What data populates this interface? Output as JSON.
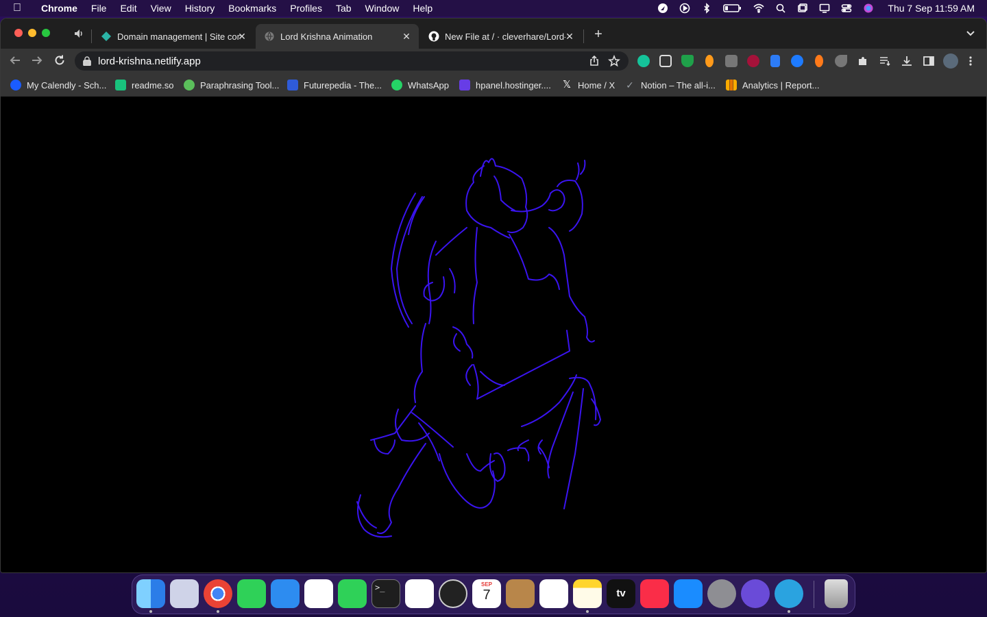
{
  "menubar": {
    "app": "Chrome",
    "menus": [
      "File",
      "Edit",
      "View",
      "History",
      "Bookmarks",
      "Profiles",
      "Tab",
      "Window",
      "Help"
    ],
    "clock": "Thu 7 Sep  11:59 AM"
  },
  "tabs": [
    {
      "title": "Domain management | Site con",
      "favicon_color": "#2bb3a6"
    },
    {
      "title": "Lord Krishna Animation",
      "favicon_color": "#9a9a9a"
    },
    {
      "title": "New File at / · cleverhare/Lord-",
      "favicon_color": "#ffffff"
    }
  ],
  "omnibox": {
    "url": "lord-krishna.netlify.app"
  },
  "bookmarks": [
    {
      "label": "My Calendly - Sch...",
      "color": "#1a5cff"
    },
    {
      "label": "readme.so",
      "color": "#19c37d"
    },
    {
      "label": "Paraphrasing Tool...",
      "color": "#5bbf5b"
    },
    {
      "label": "Futurepedia - The...",
      "color": "#2f5bd8"
    },
    {
      "label": "WhatsApp",
      "color": "#25d366"
    },
    {
      "label": "hpanel.hostinger....",
      "color": "#673de6"
    },
    {
      "label": "Home / X",
      "color": "#ffffff"
    },
    {
      "label": "Notion – The all-i...",
      "color": "#9aa0a6"
    },
    {
      "label": "Analytics | Report...",
      "color": "#f9ab00"
    }
  ],
  "artwork": {
    "stroke_color": "#3a14f0",
    "background": "#000000"
  },
  "dock": {
    "apps": [
      "Finder",
      "Launchpad",
      "Chrome",
      "Messages",
      "Mail",
      "Photos",
      "FaceTime",
      "Terminal",
      "VS Code",
      "OBS",
      "Calendar",
      "Contacts",
      "Reminders",
      "Notes",
      "TV",
      "Music",
      "App Store",
      "System Settings",
      "Webcam",
      "Telegram",
      "Trash"
    ],
    "calendar_month": "SEP",
    "calendar_day": "7",
    "tv_label": "tv"
  }
}
